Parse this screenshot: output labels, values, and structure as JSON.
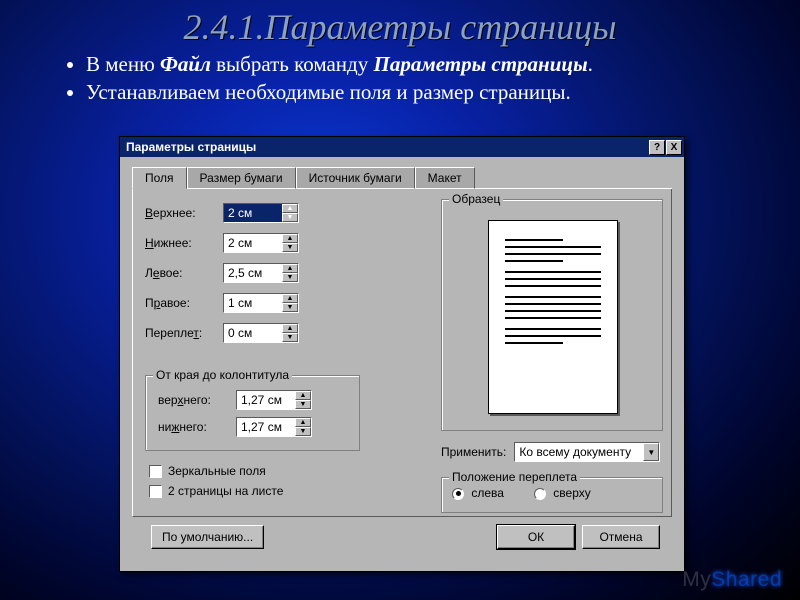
{
  "slide": {
    "title": "2.4.1.Параметры страницы",
    "bullet1_pre": "В меню ",
    "bullet1_b1": "Файл",
    "bullet1_mid": " выбрать команду ",
    "bullet1_b2": "Параметры страницы",
    "bullet1_post": ".",
    "bullet2": "Устанавливаем необходимые поля и размер страницы."
  },
  "dialog": {
    "title": "Параметры страницы",
    "help": "?",
    "close": "X",
    "tabs": {
      "fields": "Поля",
      "paper": "Размер бумаги",
      "source": "Источник бумаги",
      "layout": "Макет"
    },
    "labels": {
      "top": "Верхнее:",
      "bottom": "Нижнее:",
      "left": "Левое:",
      "right": "Правое:",
      "gutter": "Переплет:"
    },
    "values": {
      "top": "2 см",
      "bottom": "2 см",
      "left": "2,5 см",
      "right": "1 см",
      "gutter": "0 см"
    },
    "hdrgroup": "От края до колонтитула",
    "hdr_top_label": "верхнего:",
    "hdr_bot_label": "нижнего:",
    "hdr_top_val": "1,27 см",
    "hdr_bot_val": "1,27 см",
    "sample": "Образец",
    "mirror": "Зеркальные поля",
    "two_pages": "2 страницы на листе",
    "apply_label": "Применить:",
    "apply_val": "Ко всему документу",
    "bindgroup": "Положение переплета",
    "bind_left": "слева",
    "bind_top": "сверху",
    "defaults": "По умолчанию...",
    "ok": "ОК",
    "cancel": "Отмена"
  },
  "watermark": {
    "my": "My",
    "shared": "Shared"
  }
}
